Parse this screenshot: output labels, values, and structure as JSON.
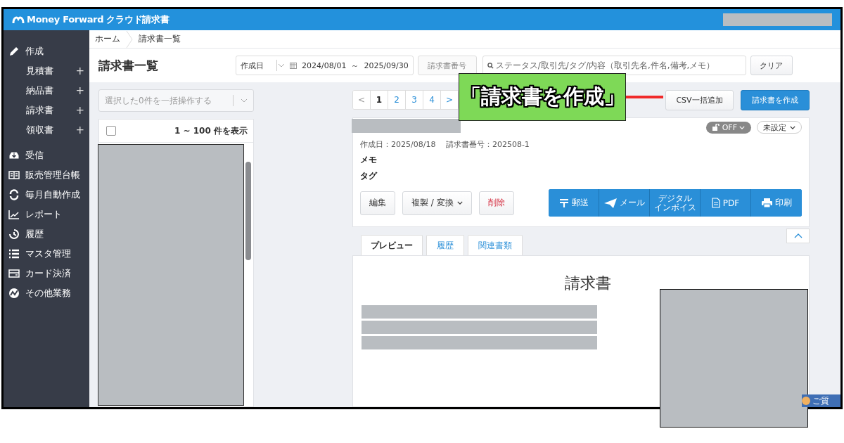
{
  "header": {
    "logo": "Money Forward クラウド請求書"
  },
  "sidebar": {
    "items": [
      {
        "label": "作成",
        "kind": "section"
      },
      {
        "label": "見積書",
        "kind": "sub",
        "action": "+"
      },
      {
        "label": "納品書",
        "kind": "sub",
        "action": "+"
      },
      {
        "label": "請求書",
        "kind": "sub",
        "action": "+"
      },
      {
        "label": "領収書",
        "kind": "sub",
        "action": "+"
      },
      {
        "label": "受信",
        "kind": "section"
      },
      {
        "label": "販売管理台帳",
        "kind": "section"
      },
      {
        "label": "毎月自動作成",
        "kind": "section"
      },
      {
        "label": "レポート",
        "kind": "section"
      },
      {
        "label": "履歴",
        "kind": "section"
      },
      {
        "label": "マスタ管理",
        "kind": "section"
      },
      {
        "label": "カード決済",
        "kind": "section"
      },
      {
        "label": "その他業務",
        "kind": "section"
      }
    ]
  },
  "breadcrumb": [
    {
      "label": "ホーム",
      "kind": "link"
    },
    {
      "label": "請求書一覧",
      "kind": "current"
    }
  ],
  "page_title": "請求書一覧",
  "filters": {
    "date_field": "作成日",
    "date_from": "2024/08/01",
    "date_sep": "～",
    "date_to": "2025/09/30",
    "number_placeholder": "請求書番号",
    "search_placeholder": "ステータス/取引先/タグ/内容（取引先名,件名,備考,メモ）",
    "clear": "クリア"
  },
  "bulk_action": {
    "placeholder": "選択した0件を一括操作する"
  },
  "list": {
    "count": "1 ~ 100 件を表示",
    "checked": false
  },
  "pagination": [
    {
      "label": "<",
      "selected": false
    },
    {
      "label": "1",
      "selected": true
    },
    {
      "label": "2",
      "selected": false
    },
    {
      "label": "3",
      "selected": false
    },
    {
      "label": "4",
      "selected": false
    },
    {
      "label": ">",
      "selected": false
    }
  ],
  "toolbar": {
    "csv": "CSV一括追加",
    "create": "請求書を作成"
  },
  "detail": {
    "lock": "OFF",
    "status": "未設定",
    "meta": "作成日：2025/08/18　 請求書番号：202508-1",
    "memo": "メモ",
    "tag": "タグ",
    "actions": [
      {
        "label": "編集",
        "kind": "plain"
      },
      {
        "label": "複製 / 変換",
        "kind": "menu"
      },
      {
        "label": "削除",
        "kind": "danger"
      }
    ],
    "send": [
      {
        "label": "郵送",
        "kind": "post"
      },
      {
        "label": "メール",
        "kind": "mail"
      },
      {
        "lines": [
          "デジタル",
          "インボイス"
        ],
        "kind": "text"
      },
      {
        "label": "PDF",
        "kind": "pdf"
      },
      {
        "label": "印刷",
        "kind": "print"
      }
    ]
  },
  "tabs": [
    {
      "label": "プレビュー",
      "selected": true
    },
    {
      "label": "履歴",
      "selected": false
    },
    {
      "label": "関連書類",
      "selected": false
    }
  ],
  "preview": {
    "title": "請求書"
  },
  "help": {
    "label": "ご質"
  },
  "callout": {
    "text": "「請求書を作成」"
  }
}
